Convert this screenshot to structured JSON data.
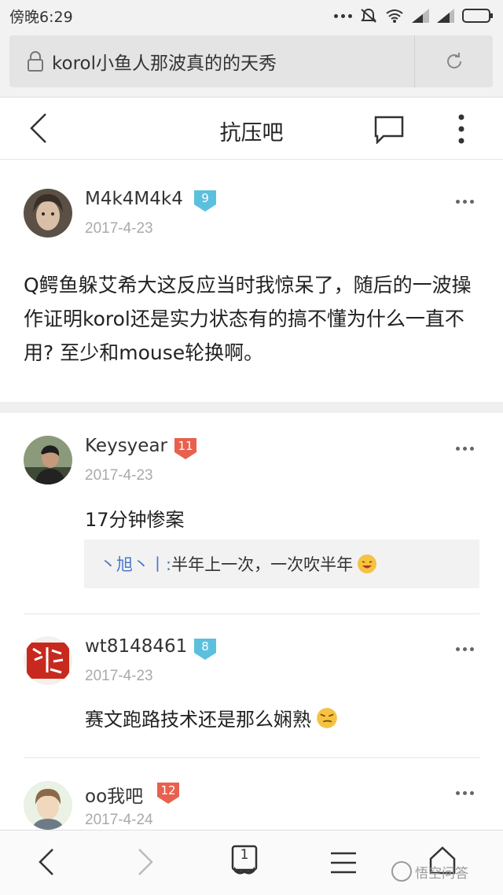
{
  "status_bar": {
    "time": "傍晚6:29"
  },
  "address_bar": {
    "url_text": "korol小鱼人那波真的的天秀"
  },
  "title_bar": {
    "title": "抗压吧"
  },
  "posts": [
    {
      "username": "M4k4M4k4",
      "level": "9",
      "level_color": "#5bc0de",
      "date": "2017-4-23",
      "body": "Q鳄鱼躲艾希大这反应当时我惊呆了，随后的一波操作证明korol还是实力状态有的搞不懂为什么一直不用? 至少和mouse轮换啊。"
    },
    {
      "username": "Keysyear",
      "level": "11",
      "level_color": "#e8614e",
      "date": "2017-4-23",
      "body": "17分钟惨案",
      "sub_reply": {
        "user": "丶旭丶丨:",
        "text": " 半年上一次，一次吹半年"
      }
    },
    {
      "username": "wt8148461",
      "level": "8",
      "level_color": "#5bc0de",
      "date": "2017-4-23",
      "body": "赛文跑路技术还是那么娴熟"
    },
    {
      "username": "oo我吧",
      "level": "12",
      "level_color": "#e8614e",
      "date": "2017-4-24"
    }
  ],
  "bottom_nav": {
    "tab_count": "1",
    "watermark": "悟空问答",
    "items": [
      "back-icon",
      "forward-icon",
      "tabs-icon",
      "menu-icon",
      "home-icon"
    ]
  }
}
